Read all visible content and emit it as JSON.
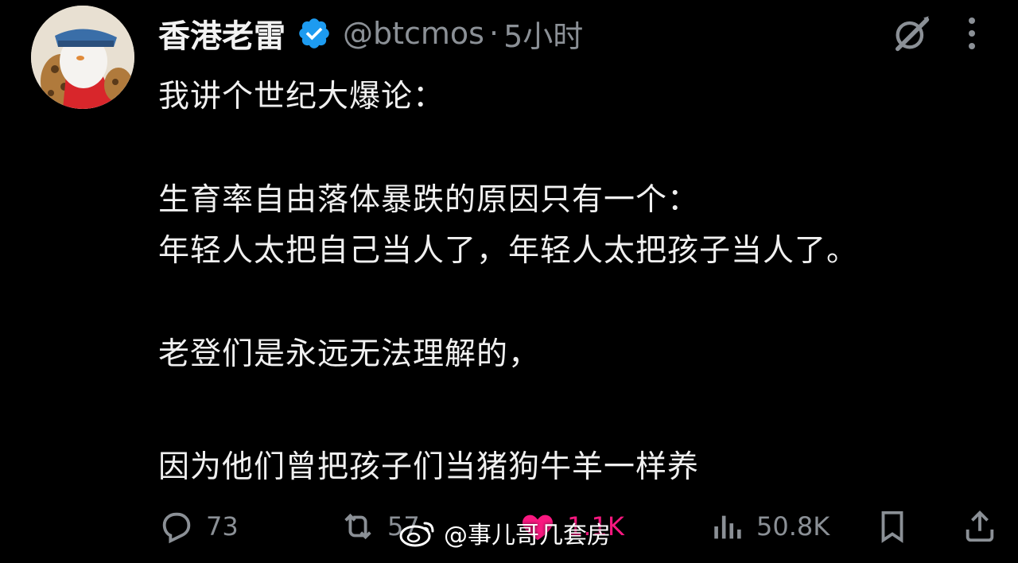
{
  "tweet": {
    "display_name": "香港老雷",
    "handle": "@btcmos",
    "separator": "·",
    "time": "5小时",
    "lines": [
      "我讲个世纪大爆论：",
      "生育率自由落体暴跌的原因只有一个：",
      "年轻人太把自己当人了，年轻人太把孩子当人了。",
      "老登们是永远无法理解的，",
      "因为他们曾把孩子们当猪狗牛羊一样养"
    ]
  },
  "actions": {
    "reply_count": "73",
    "retweet_count": "57",
    "like_count": "1.1K",
    "view_count": "50.8K"
  },
  "watermark": {
    "text": "@事儿哥几套房"
  },
  "colors": {
    "background": "#000000",
    "verified": "#1d9bf0",
    "like": "#f91880",
    "muted": "#8b9096"
  },
  "icons": {
    "verified": "verified-badge-icon",
    "grok": "grok-icon",
    "more": "more-icon",
    "reply": "reply-icon",
    "retweet": "retweet-icon",
    "like": "heart-icon",
    "views": "views-icon",
    "bookmark": "bookmark-icon",
    "share": "share-icon",
    "watermark": "weibo-icon"
  }
}
